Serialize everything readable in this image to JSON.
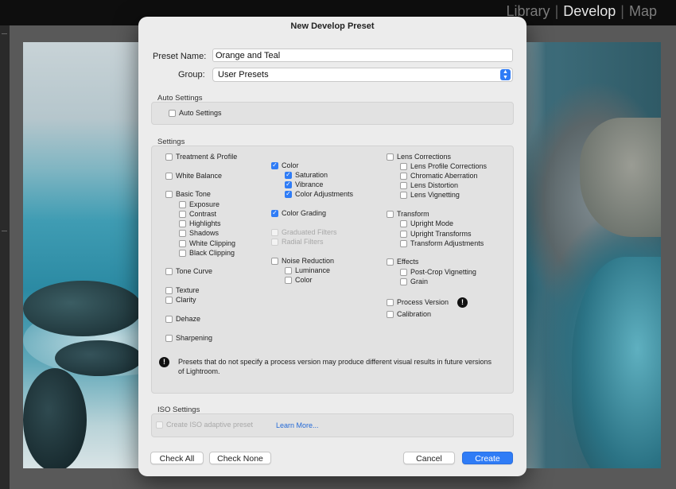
{
  "modules": [
    "Library",
    "Develop",
    "Map"
  ],
  "active_module": "Develop",
  "dialog": {
    "title": "New Develop Preset",
    "preset_name_label": "Preset Name:",
    "preset_name_value": "Orange and Teal",
    "group_label": "Group:",
    "group_value": "User Presets",
    "auto_settings_title": "Auto Settings",
    "auto_settings_checkbox": "Auto Settings",
    "settings_title": "Settings",
    "col1": {
      "treatment_profile": "Treatment & Profile",
      "white_balance": "White Balance",
      "basic_tone": "Basic Tone",
      "exposure": "Exposure",
      "contrast": "Contrast",
      "highlights": "Highlights",
      "shadows": "Shadows",
      "white_clipping": "White Clipping",
      "black_clipping": "Black Clipping",
      "tone_curve": "Tone Curve",
      "texture": "Texture",
      "clarity": "Clarity",
      "dehaze": "Dehaze",
      "sharpening": "Sharpening"
    },
    "col2": {
      "color": "Color",
      "saturation": "Saturation",
      "vibrance": "Vibrance",
      "color_adjustments": "Color Adjustments",
      "color_grading": "Color Grading",
      "graduated_filters": "Graduated Filters",
      "radial_filters": "Radial Filters",
      "noise_reduction": "Noise Reduction",
      "luminance": "Luminance",
      "nr_color": "Color"
    },
    "col3": {
      "lens_corrections": "Lens Corrections",
      "lens_profile_corrections": "Lens Profile Corrections",
      "chromatic_aberration": "Chromatic Aberration",
      "lens_distortion": "Lens Distortion",
      "lens_vignetting": "Lens Vignetting",
      "transform": "Transform",
      "upright_mode": "Upright Mode",
      "upright_transforms": "Upright Transforms",
      "transform_adjustments": "Transform Adjustments",
      "effects": "Effects",
      "post_crop_vignetting": "Post-Crop Vignetting",
      "grain": "Grain",
      "process_version": "Process Version",
      "calibration": "Calibration"
    },
    "note_text": "Presets that do not specify a process version may produce different visual results in future versions of Lightroom.",
    "iso_title": "ISO Settings",
    "iso_checkbox": "Create ISO adaptive preset",
    "learn_more": "Learn More...",
    "buttons": {
      "check_all": "Check All",
      "check_none": "Check None",
      "cancel": "Cancel",
      "create": "Create"
    }
  },
  "checked": [
    "Color",
    "Saturation",
    "Vibrance",
    "Color Adjustments",
    "Color Grading"
  ],
  "colors": {
    "accent": "#2f7cf6",
    "dialog_bg": "#ececec"
  }
}
